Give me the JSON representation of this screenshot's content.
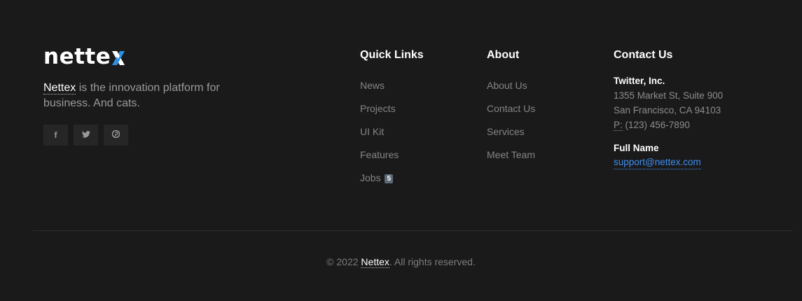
{
  "brand": {
    "logo_text": "nette",
    "tagline_brand": "Nettex",
    "tagline_rest": " is the innovation platform for business. And cats.",
    "accent_color": "#2f8fe6"
  },
  "socials": [
    {
      "icon": "facebook-icon",
      "glyph": "f"
    },
    {
      "icon": "twitter-icon",
      "glyph": "🐦"
    },
    {
      "icon": "pinterest-icon",
      "glyph": "℗"
    }
  ],
  "quick_links": {
    "title": "Quick Links",
    "items": [
      "News",
      "Projects",
      "UI Kit",
      "Features",
      "Jobs"
    ],
    "jobs_badge": "5"
  },
  "about": {
    "title": "About",
    "items": [
      "About Us",
      "Contact Us",
      "Services",
      "Meet Team"
    ]
  },
  "contact": {
    "title": "Contact Us",
    "company": "Twitter, Inc.",
    "address_line1": "1355 Market St, Suite 900",
    "address_line2": "San Francisco, CA 94103",
    "phone_label": "P:",
    "phone": " (123) 456-7890",
    "name": "Full Name",
    "email": "support@nettex.com"
  },
  "copyright": {
    "prefix": "© 2022 ",
    "brand": "Nettex",
    "suffix": ". All rights reserved."
  }
}
